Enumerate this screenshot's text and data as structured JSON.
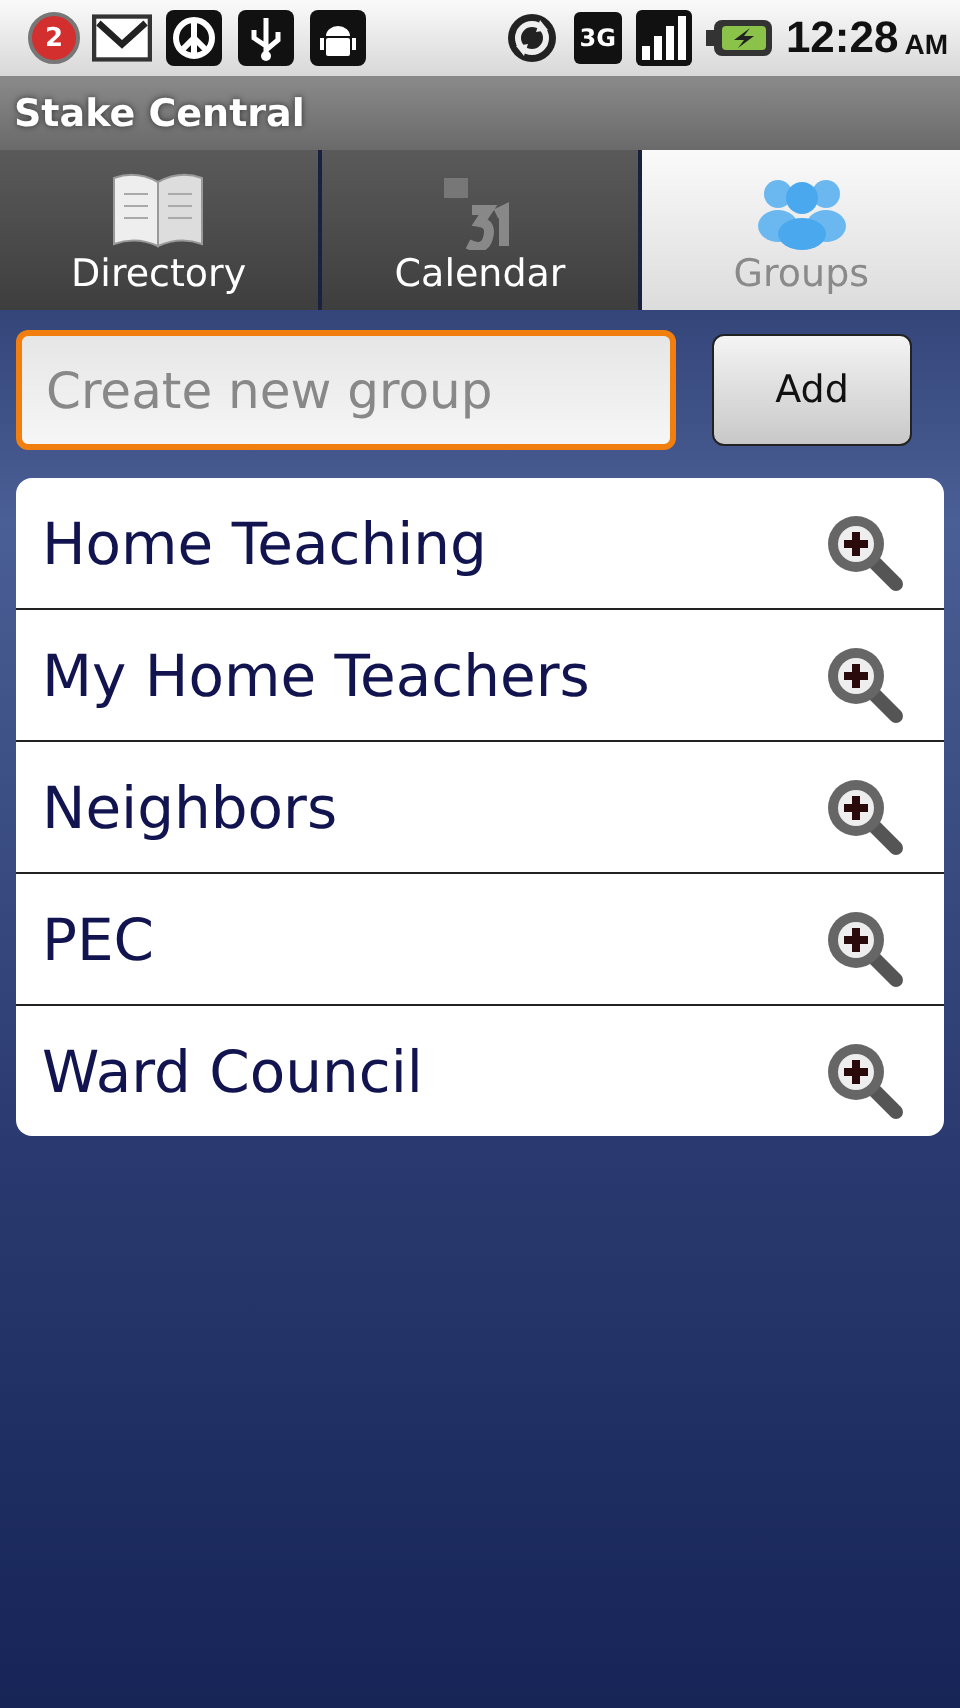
{
  "status_bar": {
    "notification_count": "2",
    "network": "3G",
    "time": "12:28",
    "meridiem": "AM"
  },
  "window": {
    "title": "Stake Central"
  },
  "tabs": [
    {
      "label": "Directory",
      "kind": "book",
      "selected": false
    },
    {
      "label": "Calendar",
      "kind": "calendar",
      "selected": false
    },
    {
      "label": "Groups",
      "kind": "people",
      "selected": true
    }
  ],
  "new_group": {
    "placeholder": "Create new group",
    "focused": true,
    "button": "Add"
  },
  "groups": [
    {
      "name": "Home Teaching"
    },
    {
      "name": "My Home Teachers"
    },
    {
      "name": "Neighbors"
    },
    {
      "name": "PEC"
    },
    {
      "name": "Ward Council"
    }
  ]
}
